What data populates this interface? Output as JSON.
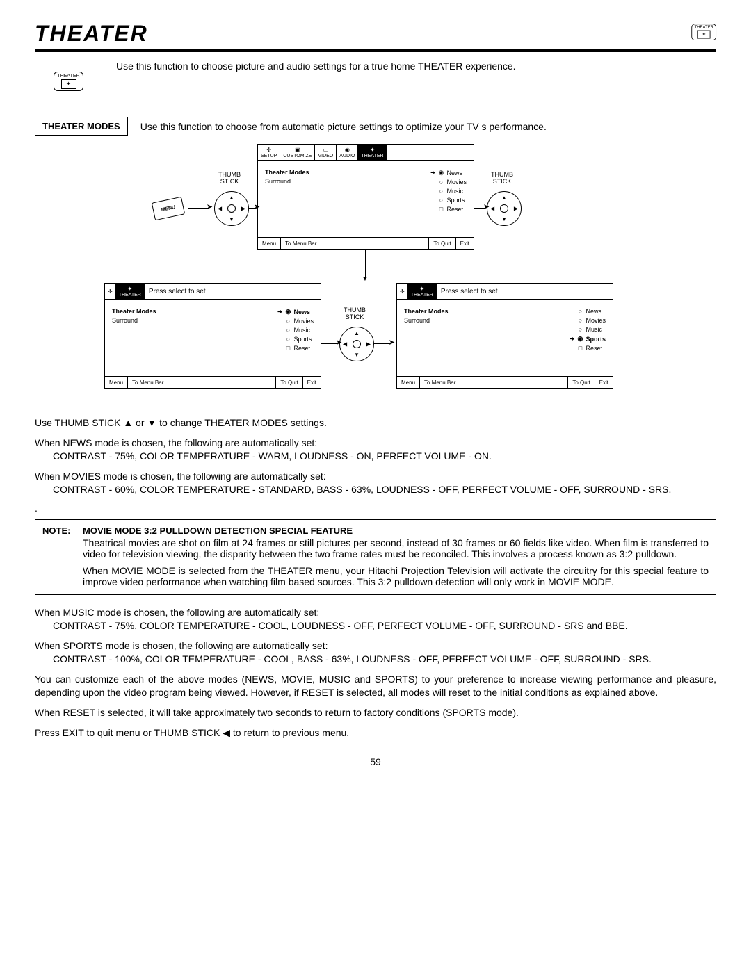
{
  "page": {
    "title": "THEATER",
    "badge_label": "THEATER",
    "intro": "Use this function to choose picture and audio settings for a true home THEATER experience.",
    "modes_label": "THEATER MODES",
    "modes_desc": "Use this function to choose from automatic picture settings to optimize your TV s performance.",
    "page_number": "59"
  },
  "diagram": {
    "thumb_label": "THUMB\nSTICK",
    "menu_btn": "MENU",
    "tabs": [
      "SETUP",
      "CUSTOMIZE",
      "VIDEO",
      "AUDIO",
      "THEATER"
    ],
    "prompt": "Press select to set",
    "left_col": [
      "Theater Modes",
      "Surround"
    ],
    "options": [
      "News",
      "Movies",
      "Music",
      "Sports",
      "Reset"
    ],
    "footer": {
      "menu": "Menu",
      "tmb": "To Menu Bar",
      "tq": "To Quit",
      "exit": "Exit"
    }
  },
  "body": {
    "use_thumb": "Use THUMB STICK ▲ or ▼ to change THEATER MODES settings.",
    "news1": "When NEWS mode is chosen, the following are automatically set:",
    "news2": "CONTRAST - 75%, COLOR TEMPERATURE - WARM, LOUDNESS - ON, PERFECT VOLUME - ON.",
    "movies1": "When MOVIES mode is chosen, the following are automatically set:",
    "movies2": "CONTRAST - 60%, COLOR TEMPERATURE - STANDARD, BASS - 63%, LOUDNESS - OFF, PERFECT VOLUME - OFF, SURROUND - SRS.",
    "dot": ".",
    "note_label": "NOTE:",
    "note_title": "MOVIE MODE 3:2 PULLDOWN DETECTION SPECIAL FEATURE",
    "note_p1": "Theatrical movies are shot on film at 24 frames or still pictures per second, instead of 30 frames or 60 fields like video.  When film is transferred to video for television viewing, the disparity between the two frame rates must be reconciled.  This involves a process known as 3:2 pulldown.",
    "note_p2": "When MOVIE MODE is selected from the THEATER menu, your Hitachi Projection Television will activate the circuitry for this special feature to improve video performance when watching film based sources.  This 3:2 pulldown detection will only work in MOVIE MODE.",
    "music1": "When MUSIC mode is chosen, the following are automatically set:",
    "music2": "CONTRAST - 75%, COLOR TEMPERATURE - COOL, LOUDNESS - OFF, PERFECT VOLUME - OFF, SURROUND - SRS and BBE.",
    "sports1": "When SPORTS mode is chosen, the following are automatically set:",
    "sports2": "CONTRAST - 100%, COLOR TEMPERATURE - COOL, BASS - 63%, LOUDNESS - OFF, PERFECT VOLUME - OFF, SURROUND - SRS.",
    "customize": "You can customize each of the above modes (NEWS, MOVIE, MUSIC and SPORTS) to your preference to increase viewing performance and pleasure, depending upon the video program being viewed. However, if RESET is selected, all modes will reset to the initial conditions as explained above.",
    "reset": "When RESET is selected, it will take approximately two seconds to return to factory conditions (SPORTS mode).",
    "exit": "Press EXIT to quit menu or THUMB STICK ◀ to return to previous menu."
  }
}
